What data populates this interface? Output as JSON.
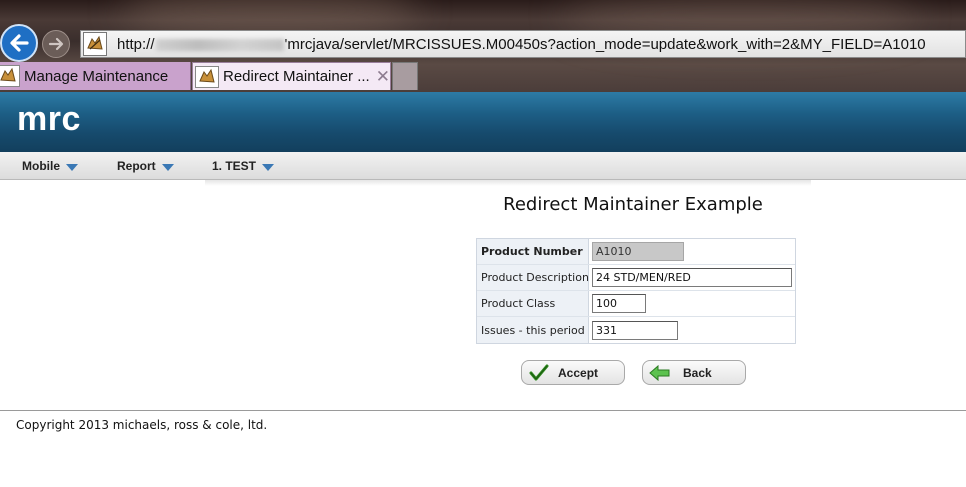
{
  "browser": {
    "address": {
      "prefix": "http://",
      "suffix": "'mrcjava/servlet/MRCISSUES.M00450s?action_mode=update&work_with=2&MY_FIELD=A1010"
    },
    "tabs": [
      {
        "label": "Manage Maintenance"
      },
      {
        "label": "Redirect Maintainer ...",
        "close": "✕"
      }
    ]
  },
  "app": {
    "title": "mrc"
  },
  "menu": {
    "items": [
      {
        "label": "Mobile"
      },
      {
        "label": "Report"
      },
      {
        "label": "1. TEST"
      }
    ]
  },
  "form": {
    "title": "Redirect Maintainer Example",
    "fields": [
      {
        "label": "Product Number",
        "value": "A1010"
      },
      {
        "label": "Product Description",
        "value": "24 STD/MEN/RED"
      },
      {
        "label": "Product Class",
        "value": "100"
      },
      {
        "label": "Issues - this period",
        "value": "331"
      }
    ],
    "buttons": {
      "accept": "Accept",
      "back": "Back"
    }
  },
  "footer": {
    "copyright": "Copyright 2013 michaels, ross & cole, ltd."
  },
  "colors": {
    "header_blue": "#1d5f86",
    "menu_caret": "#3a78b5",
    "accept_check": "#2f8a1f",
    "back_arrow": "#3fa23a"
  },
  "icons": [
    "back-arrow-icon",
    "forward-arrow-icon",
    "favicon-icon",
    "close-icon",
    "caret-down-icon",
    "checkmark-icon",
    "green-left-arrow-icon"
  ]
}
